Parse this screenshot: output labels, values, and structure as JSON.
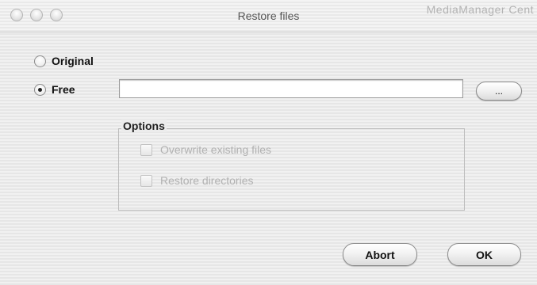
{
  "window": {
    "title": "Restore files",
    "title_overflow_text": "MediaManager Cent"
  },
  "mode": {
    "options": [
      {
        "label": "Original",
        "selected": false
      },
      {
        "label": "Free",
        "selected": true
      }
    ]
  },
  "path": {
    "value": "",
    "browse_label": "..."
  },
  "options_group": {
    "label": "Options",
    "checkboxes": [
      {
        "label": "Overwrite existing files",
        "checked": false,
        "enabled": false
      },
      {
        "label": "Restore directories",
        "checked": false,
        "enabled": false
      }
    ]
  },
  "buttons": {
    "abort_label": "Abort",
    "ok_label": "OK"
  }
}
